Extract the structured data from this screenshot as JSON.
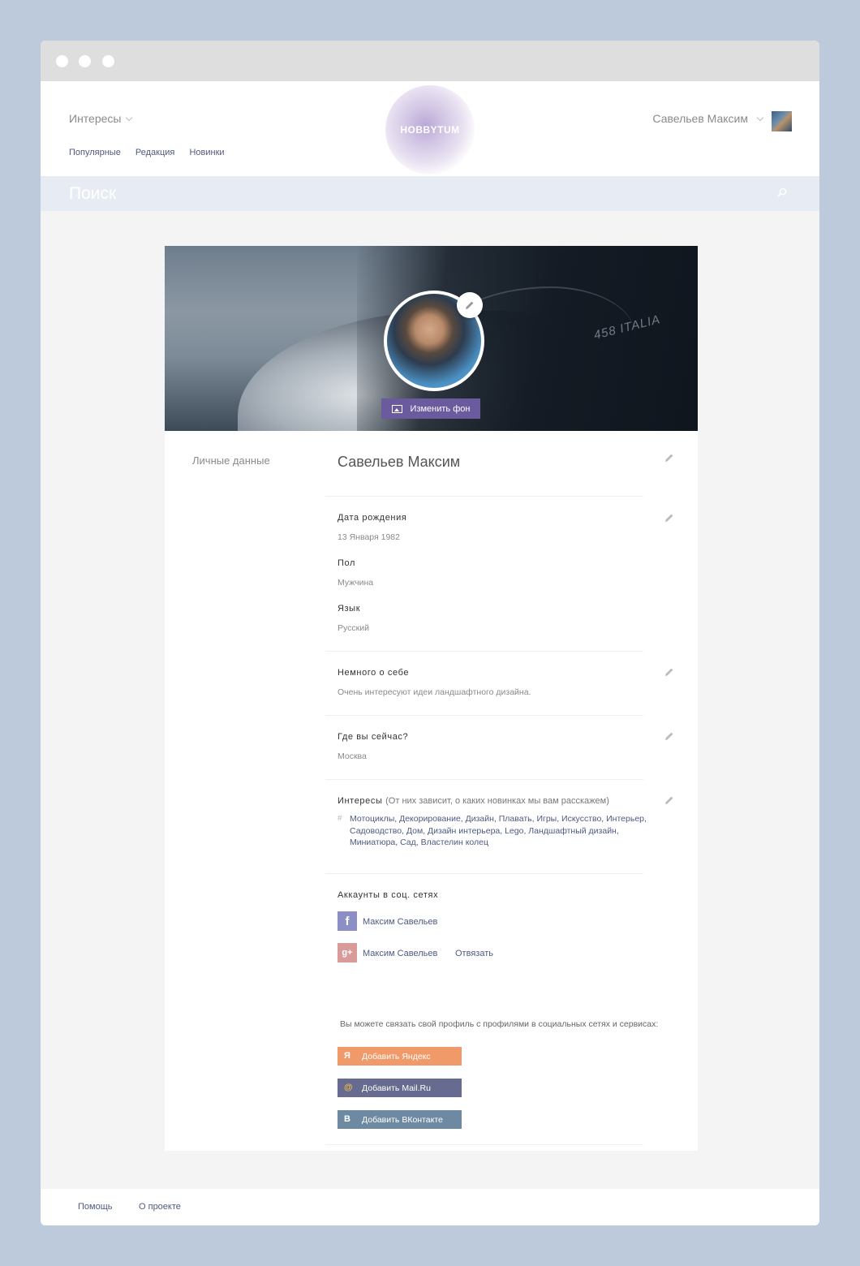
{
  "header": {
    "interests_label": "Интересы",
    "nav": [
      "Популярные",
      "Редакция",
      "Новинки"
    ],
    "logo_text": "HOBBYTUM",
    "user_name": "Савельев Максим"
  },
  "search": {
    "placeholder": "Поиск"
  },
  "profile": {
    "change_bg_label": "Изменить фон",
    "section_label": "Личные данные",
    "name": "Савельев Максим",
    "birth_label": "Дата рождения",
    "birth_value": "13 Января 1982",
    "gender_label": "Пол",
    "gender_value": "Мужчина",
    "language_label": "Язык",
    "language_value": "Русский",
    "about_label": "Немного о себе",
    "about_value": "Очень интересуют идеи ландшафтного дизайна.",
    "location_label": "Где вы сейчас?",
    "location_value": "Москва",
    "interests_label": "Интересы",
    "interests_note": "(От них зависит, о каких новинках мы вам расскажем)",
    "interests_hash": "#",
    "interests_tags": "Мотоциклы, Декорирование, Дизайн, Плавать, Игры, Искусство, Интерьер, Садоводство, Дом, Дизайн интерьера, Lego, Ландшафтный дизайн, Миниатюра, Сад, Властелин колец"
  },
  "cover_car_text": "458 ITALIA",
  "social": {
    "title": "Аккаунты в соц. сетях",
    "facebook_glyph": "f",
    "facebook_name": "Максим Савельев",
    "gplus_glyph": "g+",
    "gplus_name": "Максим Савельев",
    "unlink_label": "Отвязать",
    "hint": "Вы можете связать свой профиль с профилями в социальных сетях и сервисах:",
    "yandex_glyph": "Я",
    "yandex_label": "Добавить Яндекс",
    "mailru_glyph": "@",
    "mailru_label": "Добавить Mail.Ru",
    "vk_glyph": "B",
    "vk_label": "Добавить ВКонтакте"
  },
  "footer": {
    "help": "Помощь",
    "about": "О проекте"
  },
  "colors": {
    "accent_purple": "#6a5b9e",
    "facebook": "#8b8fc6",
    "gplus": "#d99a9a",
    "yandex": "#f09a6a",
    "mailru": "#666b8f",
    "vk": "#6e8aa3"
  },
  "icons": [
    "search-icon",
    "pencil-icon",
    "image-icon",
    "chevron-down-icon",
    "facebook-icon",
    "google-plus-icon",
    "yandex-icon",
    "mailru-icon",
    "vk-icon"
  ]
}
